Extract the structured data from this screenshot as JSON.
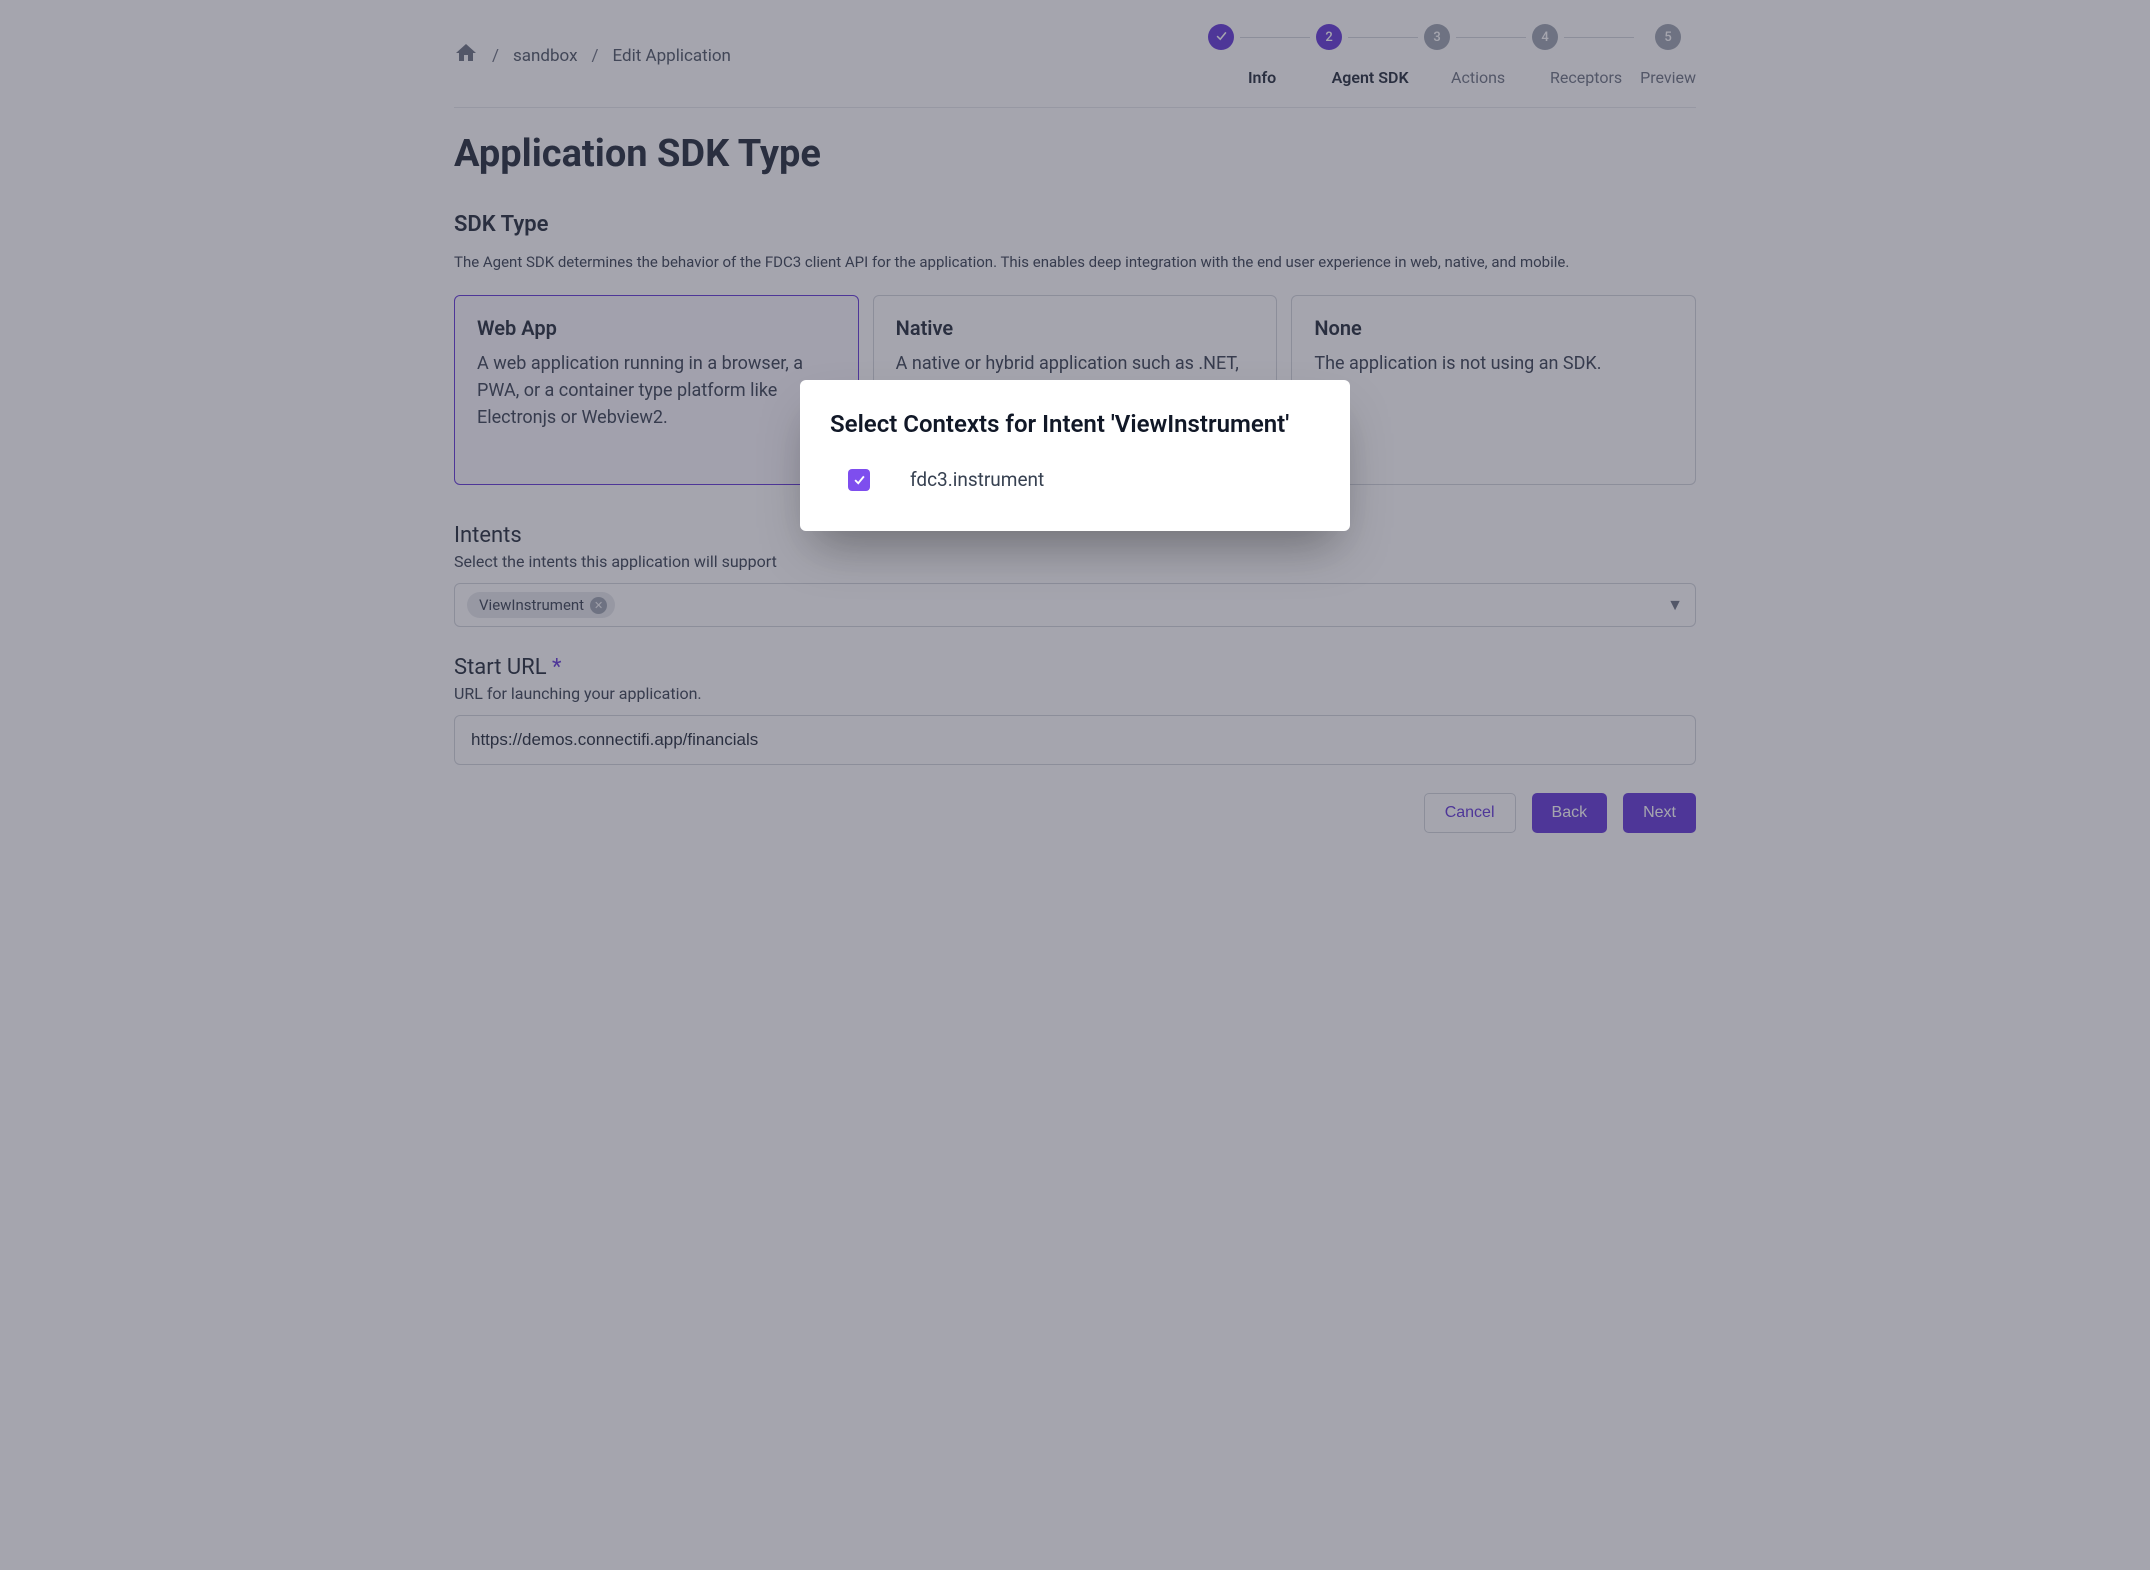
{
  "breadcrumb": {
    "items": [
      "sandbox",
      "Edit Application"
    ]
  },
  "stepper": {
    "steps": [
      {
        "num": "1",
        "label": "Info",
        "state": "done"
      },
      {
        "num": "2",
        "label": "Agent SDK",
        "state": "active"
      },
      {
        "num": "3",
        "label": "Actions",
        "state": "pending"
      },
      {
        "num": "4",
        "label": "Receptors",
        "state": "pending"
      },
      {
        "num": "5",
        "label": "Preview",
        "state": "pending"
      }
    ]
  },
  "page": {
    "title": "Application SDK Type"
  },
  "sdk_section": {
    "title": "SDK Type",
    "desc": "The Agent SDK determines the behavior of the FDC3 client API for the application. This enables deep integration with the end user experience in web, native, and mobile.",
    "cards": [
      {
        "title": "Web App",
        "desc": "A web application running in a browser, a PWA, or a container type platform like Electronjs or Webview2.",
        "selected": true
      },
      {
        "title": "Native",
        "desc": "A native or hybrid application such as .NET, Java, or Kotlin on desktop or Kotlin/Java or Objective-C/iOS/Swift.",
        "selected": false
      },
      {
        "title": "None",
        "desc": "The application is not using an SDK.",
        "selected": false
      }
    ]
  },
  "intents": {
    "label": "Intents",
    "hint": "Select the intents this application will support",
    "chip": "ViewInstrument"
  },
  "start_url": {
    "label": "Start URL",
    "hint": "URL for launching your application.",
    "value": "https://demos.connectifi.app/financials"
  },
  "buttons": {
    "cancel": "Cancel",
    "back": "Back",
    "next": "Next"
  },
  "modal": {
    "title": "Select Contexts for Intent 'ViewInstrument'",
    "option": "fdc3.instrument",
    "checked": true
  }
}
